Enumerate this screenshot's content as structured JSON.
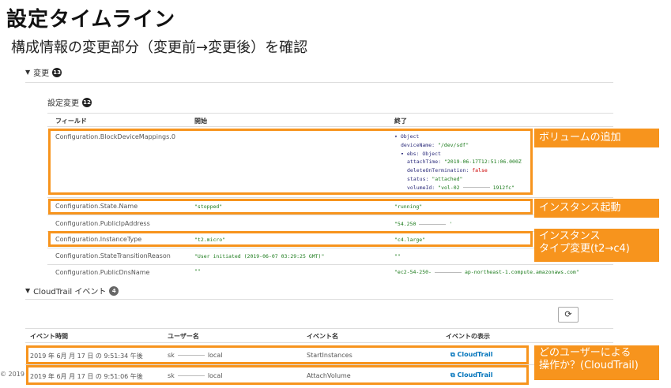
{
  "slide": {
    "title": "設定タイムライン",
    "subtitle": "構成情報の変更部分（変更前→変更後）を確認",
    "copyright": "© 2019"
  },
  "changes": {
    "toggle_icon": "caret-down-icon",
    "label": "変更",
    "count": "13"
  },
  "config_changes": {
    "label": "設定変更",
    "count": "12",
    "columns": [
      "フィールド",
      "開始",
      "終了"
    ],
    "rows": [
      {
        "field": "Configuration.BlockDeviceMappings.0",
        "start": "",
        "end": ""
      },
      {
        "field": "Configuration.State.Name",
        "start": "\"stopped\"",
        "end": "\"running\""
      },
      {
        "field": "Configuration.PublicIpAddress",
        "start": "",
        "end": "\"54.250"
      },
      {
        "field": "Configuration.InstanceType",
        "start": "\"t2.micro\"",
        "end": "\"c4.large\""
      },
      {
        "field": "Configuration.StateTransitionReason",
        "start": "\"User initiated (2019-06-07 03:29:25 GMT)\"",
        "end": "\"\""
      },
      {
        "field": "Configuration.PublicDnsName",
        "start": "\"\"",
        "end": "\"ec2-54-250-"
      }
    ],
    "public_ip_tail": "'",
    "dns_tail": "ap-northeast-1.compute.amazonaws.com\"",
    "object_tree": {
      "root": "▾ Object",
      "deviceName_key": "deviceName:",
      "deviceName_val": "\"/dev/sdf\"",
      "ebs_line": "▾ ebs: Object",
      "attachTime_key": "attachTime:",
      "attachTime_val": "\"2019-06-17T12:51:06.000Z",
      "dot_key": "deleteOnTermination:",
      "dot_val": "false",
      "status_key": "status:",
      "status_val": "\"attached\"",
      "volumeId_key": "volumeId:",
      "volumeId_val": "\"vol-02",
      "volumeId_tail": "1912fc\""
    }
  },
  "cloudtrail": {
    "label": "CloudTrail イベント",
    "count": "4",
    "refresh_icon": "refresh-icon",
    "columns": [
      "イベント時間",
      "ユーザー名",
      "イベント名",
      "イベントの表示"
    ],
    "rows": [
      {
        "time": "2019 年 6月 月 17 日 の 9:51:34 午後",
        "user_prefix": "sk",
        "user_suffix": "local",
        "event": "StartInstances",
        "view": "CloudTrail"
      },
      {
        "time": "2019 年 6月 月 17 日 の 9:51:06 午後",
        "user_prefix": "sk",
        "user_suffix": "local",
        "event": "AttachVolume",
        "view": "CloudTrail"
      }
    ]
  },
  "annotations": {
    "volume_add": "ボリュームの追加",
    "instance_start": "インスタンス起動",
    "type_change_line1": "インスタンス",
    "type_change_line2": "タイプ変更(t2→c4)",
    "who_line1": "どのユーザーによる",
    "who_line2": "操作か？(CloudTrail)"
  },
  "colors": {
    "highlight": "#f7941d",
    "link": "#0073bb"
  }
}
